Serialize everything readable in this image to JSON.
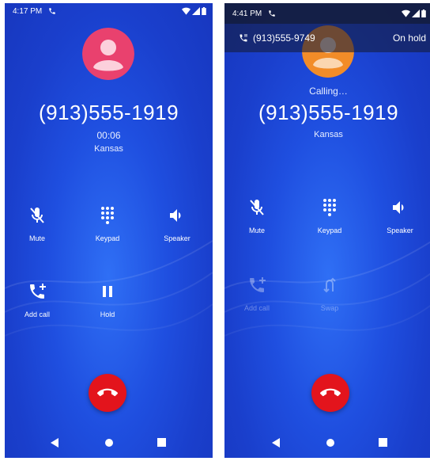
{
  "left": {
    "status": {
      "time": "4:17 PM"
    },
    "phone_number": "(913)555-1919",
    "duration": "00:06",
    "location": "Kansas",
    "buttons": {
      "mute": "Mute",
      "keypad": "Keypad",
      "speaker": "Speaker",
      "add_call": "Add call",
      "hold": "Hold"
    },
    "colors": {
      "avatar_bg": "#e9416e",
      "end_call": "#e3141c"
    }
  },
  "right": {
    "status": {
      "time": "4:41 PM"
    },
    "hold_banner": {
      "number": "(913)555-9749",
      "state": "On hold"
    },
    "call_state": "Calling…",
    "phone_number": "(913)555-1919",
    "location": "Kansas",
    "buttons": {
      "mute": "Mute",
      "keypad": "Keypad",
      "speaker": "Speaker",
      "add_call": "Add call",
      "swap": "Swap"
    },
    "colors": {
      "avatar_bg": "#f28c28",
      "end_call": "#e3141c"
    }
  },
  "icons": {
    "mute": "mic-off-icon",
    "keypad": "dialpad-icon",
    "speaker": "volume-icon",
    "add_call": "add-call-icon",
    "hold": "pause-icon",
    "swap": "swap-calls-icon",
    "end_call": "call-end-icon"
  }
}
